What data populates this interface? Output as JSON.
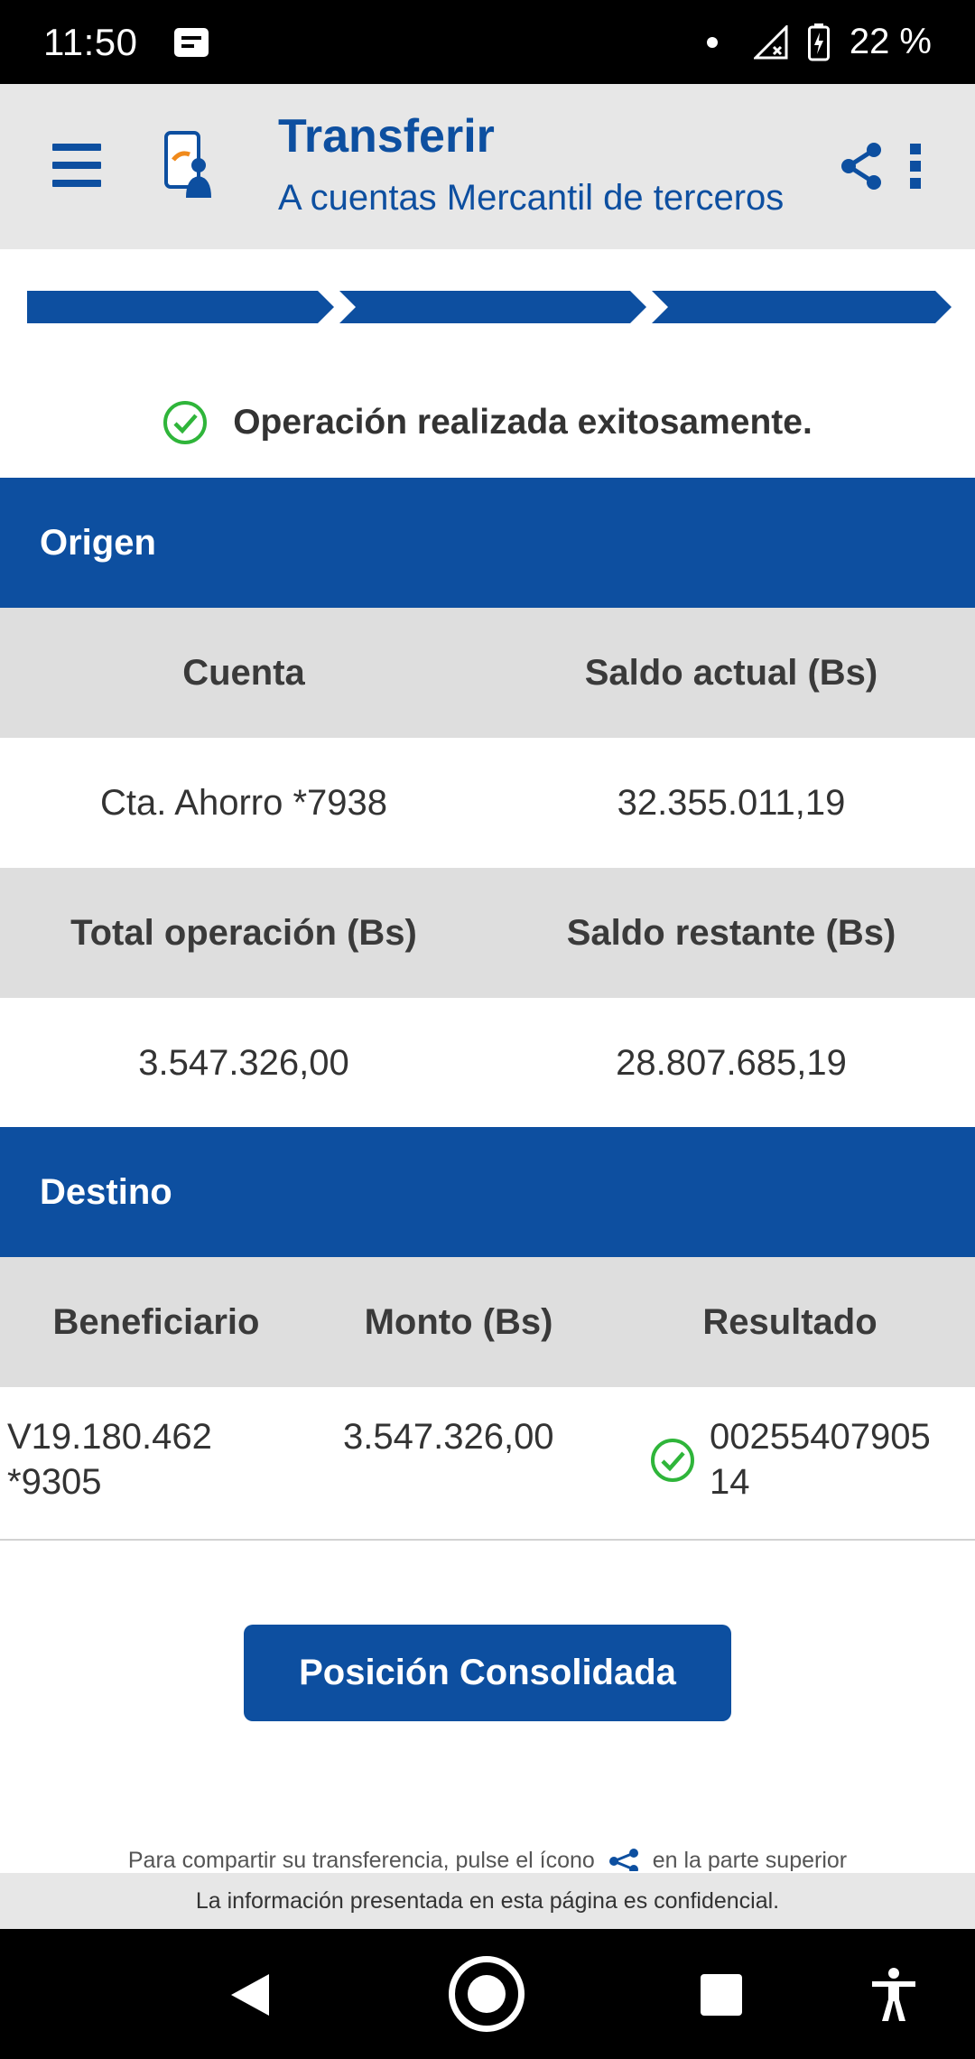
{
  "status_bar": {
    "time": "11:50",
    "battery": "22 %"
  },
  "app_bar": {
    "title": "Transferir",
    "subtitle": "A cuentas Mercantil de terceros",
    "icons": [
      "menu-icon",
      "app-logo-icon",
      "share-icon",
      "more-vert-icon"
    ]
  },
  "stepper": {
    "steps": 3,
    "completed": 3
  },
  "success": {
    "message": "Operación realizada exitosamente."
  },
  "origen": {
    "header": "Origen",
    "col_cuenta": "Cuenta",
    "col_saldo_actual": "Saldo actual (Bs)",
    "cuenta": "Cta. Ahorro *7938",
    "saldo_actual": "32.355.011,19",
    "col_total_operacion": "Total operación (Bs)",
    "col_saldo_restante": "Saldo restante (Bs)",
    "total_operacion": "3.547.326,00",
    "saldo_restante": "28.807.685,19"
  },
  "destino": {
    "header": "Destino",
    "col_beneficiario": "Beneficiario",
    "col_monto": "Monto (Bs)",
    "col_resultado": "Resultado",
    "beneficiario": "V19.180.462 *9305",
    "monto": "3.547.326,00",
    "resultado": "0025540790514"
  },
  "cta_button": "Posición Consolidada",
  "share_hint_before": "Para compartir su transferencia, pulse el ícono",
  "share_hint_after": "en la parte superior",
  "footer": "La información presentada en esta página es confidencial.",
  "colors": {
    "primary": "#0d4fa0",
    "success": "#2fb53a",
    "row_gray": "#dedede",
    "app_bar": "#e7e7e7"
  }
}
